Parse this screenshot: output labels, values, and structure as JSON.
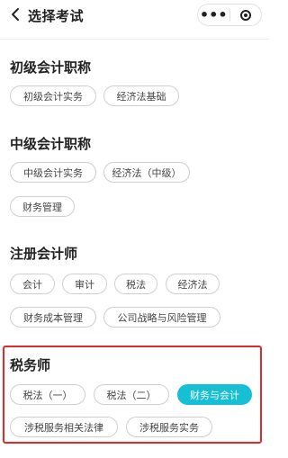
{
  "header": {
    "title": "选择考试",
    "back_icon": "chevron-left-icon",
    "more_icon": "more-dots-icon",
    "close_icon": "target-icon"
  },
  "sections": [
    {
      "title": "初级会计职称",
      "items": [
        "初级会计实务",
        "经济法基础"
      ]
    },
    {
      "title": "中级会计职称",
      "items": [
        "中级会计实务",
        "经济法（中级）",
        "财务管理"
      ]
    },
    {
      "title": "注册会计师",
      "items": [
        "会计",
        "审计",
        "税法",
        "经济法",
        "财务成本管理",
        "公司战略与风险管理"
      ]
    },
    {
      "title": "税务师",
      "items": [
        "税法（一）",
        "税法（二）",
        "财务与会计",
        "涉税服务相关法律",
        "涉税服务实务"
      ],
      "selected": "财务与会计"
    }
  ],
  "colors": {
    "accent": "#17bfd4",
    "highlight_border": "#e12b2b"
  }
}
